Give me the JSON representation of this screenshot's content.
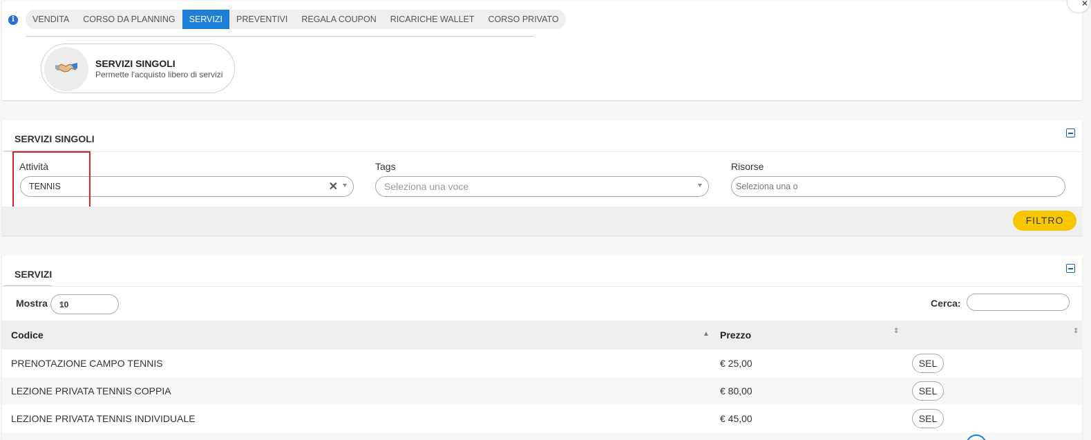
{
  "tabs": [
    {
      "label": "VENDITA",
      "active": false
    },
    {
      "label": "CORSO DA PLANNING",
      "active": false
    },
    {
      "label": "SERVIZI",
      "active": true
    },
    {
      "label": "PREVENTIVI",
      "active": false
    },
    {
      "label": "REGALA COUPON",
      "active": false
    },
    {
      "label": "RICARICHE WALLET",
      "active": false
    },
    {
      "label": "CORSO PRIVATO",
      "active": false
    }
  ],
  "info_icon": {
    "glyph": "i",
    "icon": "info-icon"
  },
  "service_card": {
    "icon": "handshake-icon",
    "title": "SERVIZI SINGOLI",
    "subtitle": "Permette l'acquisto libero di servizi"
  },
  "filter_panel": {
    "title": "SERVIZI SINGOLI",
    "attivita": {
      "label": "Attività",
      "value": "TENNIS"
    },
    "tags": {
      "label": "Tags",
      "placeholder": "Seleziona una voce"
    },
    "risorse": {
      "label": "Risorse",
      "placeholder": "Seleziona una o"
    },
    "filter_button": "FILTRO"
  },
  "services_panel": {
    "title": "SERVIZI",
    "show_label": "Mostra",
    "show_value": "10",
    "search_label": "Cerca:",
    "columns": [
      "Codice",
      "Prezzo",
      ""
    ],
    "rows": [
      {
        "codice": "PRENOTAZIONE CAMPO TENNIS",
        "prezzo": "€ 25,00",
        "action": "SEL"
      },
      {
        "codice": "LEZIONE PRIVATA TENNIS COPPIA",
        "prezzo": "€ 80,00",
        "action": "SEL"
      },
      {
        "codice": "LEZIONE PRIVATA TENNIS INDIVIDUALE",
        "prezzo": "€ 45,00",
        "action": "SEL"
      }
    ]
  },
  "colors": {
    "active_tab": "#1e7fd8",
    "filter_button": "#f7c700",
    "highlight": "#e0201f"
  }
}
